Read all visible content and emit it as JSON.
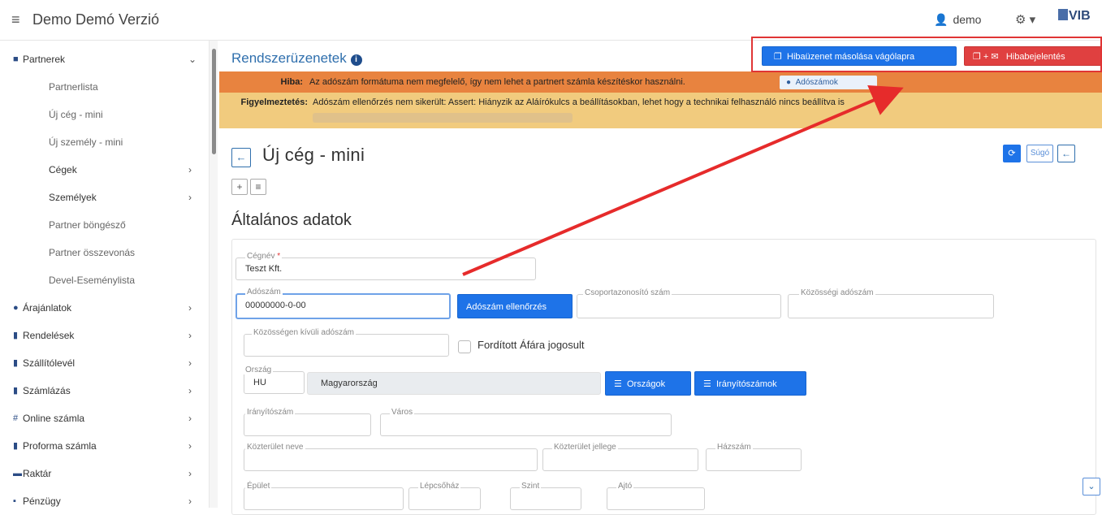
{
  "topbar": {
    "title": "Demo Demó Verzió",
    "user": "demo",
    "gear_caret": "▾",
    "logo_text": "VIB"
  },
  "sidebar": {
    "items": [
      {
        "label": "Partnerek",
        "icon": "book-icon",
        "arrow": "⌄"
      },
      {
        "label": "Partnerlista"
      },
      {
        "label": "Új cég - mini"
      },
      {
        "label": "Új személy - mini"
      },
      {
        "label": "Cégek",
        "arrow": "›"
      },
      {
        "label": "Személyek",
        "arrow": "›"
      },
      {
        "label": "Partner böngésző"
      },
      {
        "label": "Partner összevonás"
      },
      {
        "label": "Devel-Eseménylista"
      },
      {
        "label": "Árajánlatok",
        "icon": "users-icon",
        "arrow": "›"
      },
      {
        "label": "Rendelések",
        "icon": "file-icon",
        "arrow": "›"
      },
      {
        "label": "Szállítólevél",
        "icon": "file-icon",
        "arrow": "›"
      },
      {
        "label": "Számlázás",
        "icon": "file-icon",
        "arrow": "›"
      },
      {
        "label": "Online számla",
        "icon": "hash-icon",
        "arrow": "›"
      },
      {
        "label": "Proforma számla",
        "icon": "file-icon",
        "arrow": "›"
      },
      {
        "label": "Raktár",
        "icon": "warehouse-icon",
        "arrow": "›"
      },
      {
        "label": "Pénzügy",
        "icon": "money-icon",
        "arrow": "›"
      }
    ]
  },
  "system": {
    "title": "Rendszerüzenetek",
    "copy_button": "Hibaüzenet másolása vágólapra",
    "report_button": "Hibabejelentés",
    "error_label": "Hiba:",
    "error_text": "Az adószám formátuma nem megfelelő, így nem lehet a partnert számla készítéskor használni.",
    "error_link": "Adószámok",
    "warning_label": "Figyelmeztetés:",
    "warning_text": "Adószám ellenőrzés nem sikerült: Assert: Hiányzik az Aláírókulcs a beállításokban, lehet hogy a technikai felhasználó nincs beállítva is"
  },
  "page": {
    "title": "Új cég - mini",
    "help": "Súgó",
    "section": "Általános adatok"
  },
  "form": {
    "cegnev_label": "Cégnév",
    "cegnev_value": "Teszt Kft.",
    "adoszam_label": "Adószám",
    "adoszam_value": "00000000-0-00",
    "adoszam_check_button": "Adószám ellenőrzés",
    "csoport_label": "Csoportazonosító szám",
    "kozossegi_label": "Közösségi adószám",
    "kozossegen_kivuli_label": "Közösségen kívüli adószám",
    "forditott_afa_label": "Fordított Áfára jogosult",
    "orszag_label": "Ország",
    "orszag_code": "HU",
    "orszag_name": "Magyarország",
    "orszagok_button": "Országok",
    "iranyitoszamok_button": "Irányítószámok",
    "iranyitoszam_label": "Irányítószám",
    "varos_label": "Város",
    "kozterulet_neve_label": "Közterület neve",
    "kozterulet_jellege_label": "Közterület jellege",
    "hazszam_label": "Házszám",
    "epulet_label": "Épület",
    "lepcsohaz_label": "Lépcsőház",
    "szint_label": "Szint",
    "ajto_label": "Ajtó"
  },
  "colors": {
    "accent": "#1e73e8",
    "danger": "#e04040",
    "error_bg": "#e8833f",
    "warning_bg": "#f1cb7e"
  }
}
